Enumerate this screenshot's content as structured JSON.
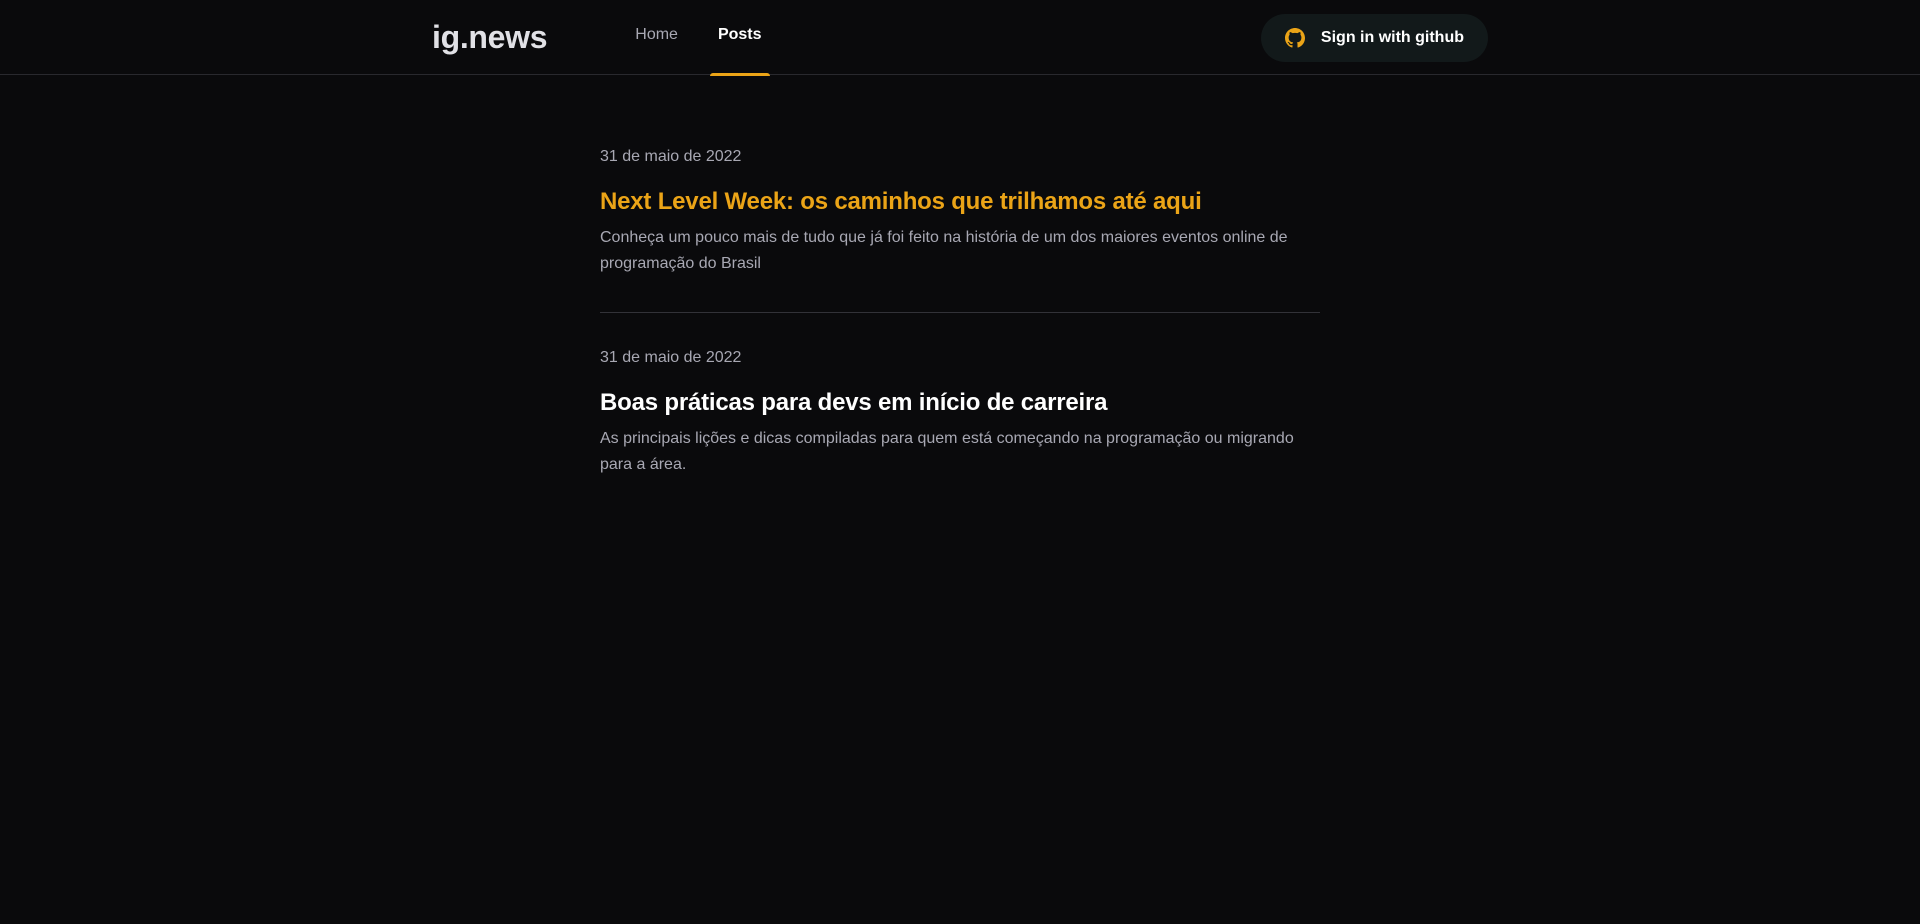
{
  "header": {
    "logo": "ig.news",
    "nav": [
      {
        "label": "Home",
        "active": false
      },
      {
        "label": "Posts",
        "active": true
      }
    ],
    "signin_label": "Sign in with github",
    "signin_icon": "github-icon"
  },
  "colors": {
    "background": "#0a0a0c",
    "accent": "#eba417",
    "muted_text": "#a8a8b3",
    "button_bg": "#12191a"
  },
  "posts": [
    {
      "date": "31 de maio de 2022",
      "title": "Next Level Week: os caminhos que trilhamos até aqui",
      "excerpt": "Conheça um pouco mais de tudo que já foi feito na história de um dos maiores eventos online de programação do Brasil"
    },
    {
      "date": "31 de maio de 2022",
      "title": "Boas práticas para devs em início de carreira",
      "excerpt": "As principais lições e dicas compiladas para quem está começando na programação ou migrando para a área."
    }
  ]
}
